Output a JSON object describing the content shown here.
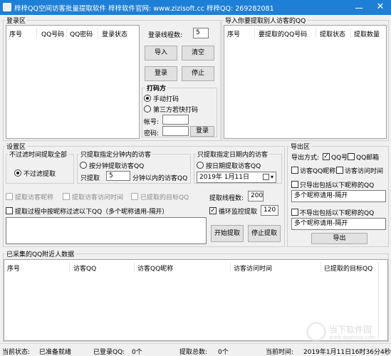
{
  "window": {
    "title": "梓梓QQ空间访客批量提取软件  梓梓软件官网: www.zizisoft.cc  梓梓QQ: 269282081",
    "close_glyph": "✕"
  },
  "login": {
    "group_label": "登录区",
    "columns": [
      "序号",
      "QQ号码",
      "QQ密码",
      "登录状态"
    ],
    "thread_label": "登录线程数:",
    "thread_value": "5",
    "import_label": "导入",
    "clear_label": "清空",
    "login_label": "登录",
    "stop_label": "停止"
  },
  "captcha": {
    "group_label": "打码方",
    "manual_label": "手动打码",
    "thirdparty_label": "第三方若快打码",
    "account_label": "帐号:",
    "password_label": "密码:",
    "login_label": "登录"
  },
  "import_targets": {
    "group_label": "导入你要提取别人访客的QQ",
    "columns": [
      "序号",
      "要提取的QQ号码",
      "提取状态",
      "提取数量"
    ]
  },
  "settings": {
    "group_label": "设置区",
    "no_filter_group": "不过滤时间提取全部",
    "no_filter_radio": "不过滤提取",
    "minutes_group": "只提取指定分钟内的访客",
    "minutes_radio": "按分钟提取访客QQ",
    "minutes_prefix": "只提取",
    "minutes_value": "5",
    "minutes_suffix": "分钟以内的访客QQ",
    "date_group": "只提取指定日期内的访客",
    "date_radio": "按日期提取访客QQ",
    "date_value": "2019年  1月11日",
    "cb_nickname": "提取访客昵称",
    "cb_visit_time": "提取访客访问时间",
    "cb_target": "已提取的目标QQ",
    "extract_threads_label": "提取线程数:",
    "extract_threads_value": "200",
    "filter_nickname_label": "提取过程中按昵称过滤以下QQ（多个昵称请用-隔开）",
    "loop_monitor_label": "循环监控提取",
    "loop_value": "120",
    "start_label": "开始提取",
    "stop_label": "停止提取"
  },
  "export": {
    "group_label": "导出区",
    "method_label": "导出方式:",
    "qq_label": "QQ号",
    "email_label": "QQ邮箱",
    "visitor_nick_label": "访客QQ昵称",
    "visitor_time_label": "访客访问时间",
    "only_include_label": "只导出包括以下昵称的QQ",
    "only_include_value": "多个昵称请用-隔开",
    "exclude_label": "不导出包括以下昵称的QQ",
    "exclude_value": "多个昵称请用-隔开",
    "export_label": "导出"
  },
  "collected": {
    "group_label": "已采集的QQ附近人数据",
    "columns": [
      "序号",
      "访客QQ",
      "访客QQ昵称",
      "访客访问时间",
      "已提取的目标QQ"
    ]
  },
  "watermark": {
    "name": "当下软件园",
    "url": "www.downxia.com"
  },
  "status": {
    "state_label": "当前状态:",
    "state_value": "已准备就绪",
    "logged_label": "已登录QQ:",
    "logged_value": "0个",
    "total_label": "提取总数:",
    "total_value": "0个",
    "time_label": "当前时间:",
    "time_value": "2019年1月11日16时36分4秒"
  }
}
